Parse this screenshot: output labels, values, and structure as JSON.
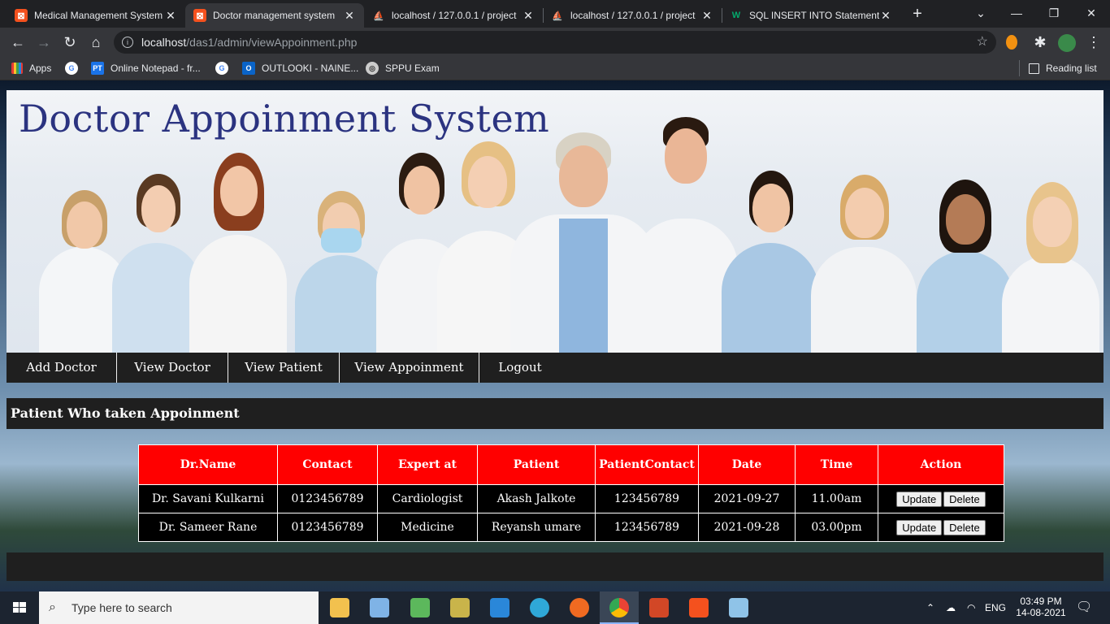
{
  "browser": {
    "tabs": [
      {
        "title": "Medical Management System",
        "active": false
      },
      {
        "title": "Doctor management system",
        "active": true
      },
      {
        "title": "localhost / 127.0.0.1 / project",
        "active": false
      },
      {
        "title": "localhost / 127.0.0.1 / project",
        "active": false
      },
      {
        "title": "SQL INSERT INTO Statement",
        "active": false
      }
    ],
    "url_host": "localhost",
    "url_path": "/das1/admin/viewAppoinment.php",
    "bookmarks": [
      "Apps",
      "Online Notepad - fr...",
      "OUTLOOKI - NAINE...",
      "SPPU Exam"
    ],
    "reading_list": "Reading list"
  },
  "site": {
    "title": "Doctor Appoinment System",
    "nav": [
      "Add Doctor",
      "View Doctor",
      "View Patient",
      "View Appoinment",
      "Logout"
    ],
    "section_title": "Patient Who taken Appoinment"
  },
  "table": {
    "headers": [
      "Dr.Name",
      "Contact",
      "Expert at",
      "Patient",
      "PatientContact",
      "Date",
      "Time",
      "Action"
    ],
    "rows": [
      {
        "dr_name": "Dr. Savani Kulkarni",
        "contact": "0123456789",
        "expert_at": "Cardiologist",
        "patient": "Akash Jalkote",
        "patient_contact": "123456789",
        "date": "2021-09-27",
        "time": "11.00am"
      },
      {
        "dr_name": "Dr. Sameer Rane",
        "contact": "0123456789",
        "expert_at": "Medicine",
        "patient": "Reyansh umare",
        "patient_contact": "123456789",
        "date": "2021-09-28",
        "time": "03.00pm"
      }
    ],
    "update_label": "Update",
    "delete_label": "Delete"
  },
  "taskbar": {
    "search_placeholder": "Type here to search",
    "lang": "ENG",
    "time": "03:49 PM",
    "date": "14-08-2021"
  },
  "colors": {
    "table_header": "#ff0000",
    "banner_title": "#2b3380",
    "nav_bg": "#1f1f1f"
  }
}
